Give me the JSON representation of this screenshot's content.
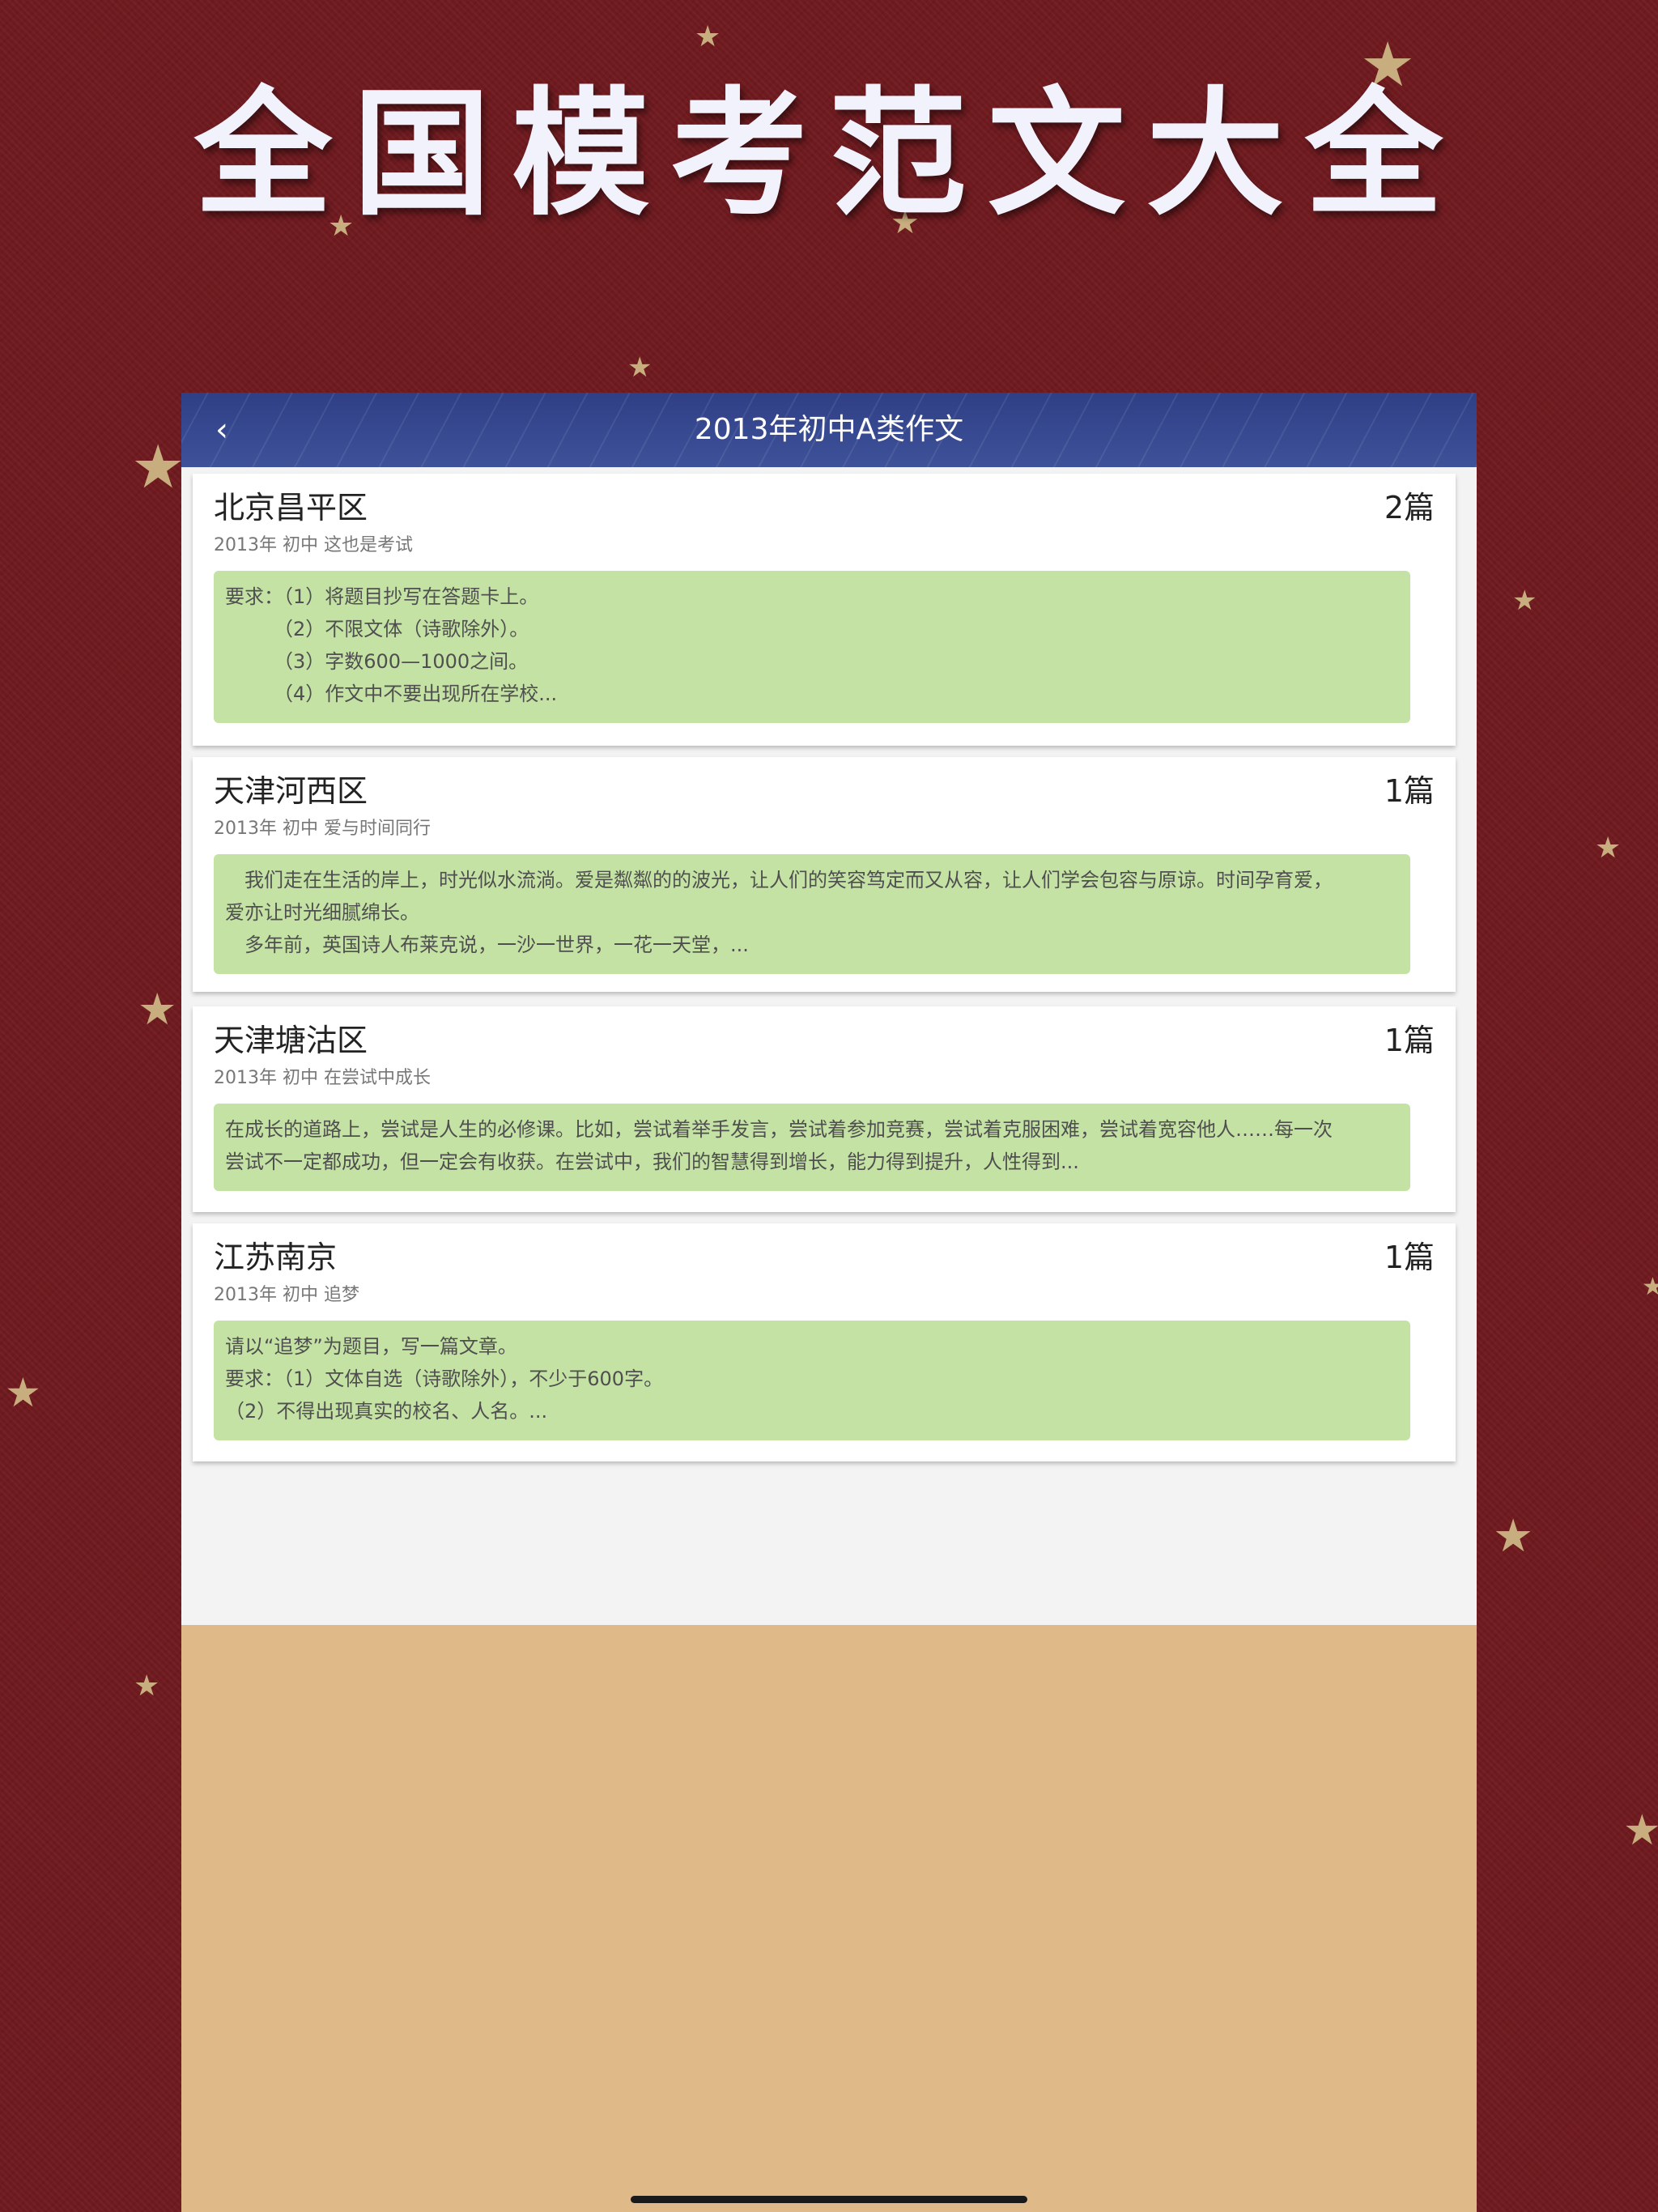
{
  "headline": "全国模考范文大全",
  "app": {
    "title": "2013年初中A类作文",
    "back_icon": "chevron-left-icon"
  },
  "essays": [
    {
      "region": "北京昌平区",
      "count": "2篇",
      "meta": "2013年 初中 这也是考试",
      "excerpt_lines": [
        "要求：（1）将题目抄写在答题卡上。",
        "　　　（2）不限文体（诗歌除外）。",
        "　　　（3）字数600—1000之间。",
        "　　　（4）作文中不要出现所在学校..."
      ]
    },
    {
      "region": "天津河西区",
      "count": "1篇",
      "meta": "2013年 初中 爱与时间同行",
      "excerpt_lines": [
        "　我们走在生活的岸上，时光似水流淌。爱是粼粼的的波光，让人们的笑容笃定而又从容，让人们学会包容与原谅。时间孕育爱，",
        "爱亦让时光细腻绵长。",
        "　多年前，英国诗人布莱克说，一沙一世界，一花一天堂，..."
      ]
    },
    {
      "region": "天津塘沽区",
      "count": "1篇",
      "meta": "2013年 初中 在尝试中成长",
      "excerpt_lines": [
        "在成长的道路上，尝试是人生的必修课。比如，尝试着举手发言，尝试着参加竞赛，尝试着克服困难，尝试着宽容他人……每一次",
        "尝试不一定都成功，但一定会有收获。在尝试中，我们的智慧得到增长，能力得到提升，人性得到..."
      ]
    },
    {
      "region": "江苏南京",
      "count": "1篇",
      "meta": "2013年 初中 追梦",
      "excerpt_lines": [
        "请以“追梦”为题目，写一篇文章。",
        "要求：（1）文体自选（诗歌除外），不少于600字。",
        "（2）不得出现真实的校名、人名。..."
      ]
    }
  ],
  "colors": {
    "background": "#6f1a1f",
    "appbar": "#34448b",
    "excerpt_bg": "#c5e2a5",
    "device_bg": "#dfb987",
    "star": "#c8ae7e"
  }
}
